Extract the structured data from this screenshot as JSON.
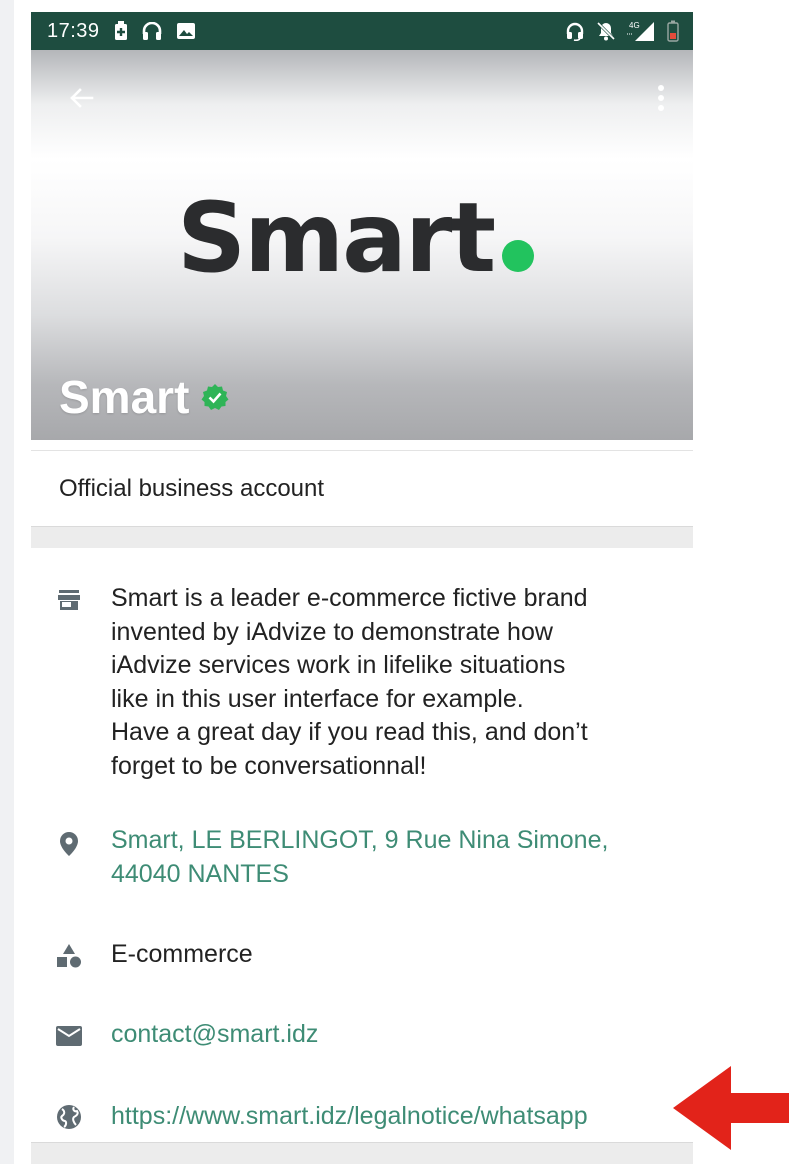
{
  "status_bar": {
    "time": "17:39",
    "left_icons": [
      "battery-saver-icon",
      "headphones-icon",
      "image-icon"
    ],
    "right_icons": [
      "headset-icon",
      "mute-notifications-icon",
      "4g-signal-icon",
      "battery-icon"
    ],
    "network": "4G"
  },
  "header": {
    "back_icon": "arrow-back-icon",
    "menu_icon": "more-vert-icon",
    "logo_text": "Smart",
    "business_name": "Smart",
    "verified_icon": "verified-badge-icon"
  },
  "official": {
    "label": "Official business account"
  },
  "info": {
    "description": "Smart is a leader e-commerce fictive brand\ninvented by iAdvize to demonstrate how\niAdvize services work in lifelike situations\nlike in this user interface for example.\nHave a great day if you read this, and don’t\nforget to be conversationnal!",
    "address": "Smart, LE BERLINGOT, 9 Rue Nina Simone,\n44040 NANTES",
    "category": "E-commerce",
    "email": "contact@smart.idz",
    "website": "https://www.smart.idz/legalnotice/whatsapp"
  },
  "annotation": {
    "icon": "red-arrow-icon",
    "color": "#e2231a"
  },
  "colors": {
    "status_bar": "#1e4d40",
    "link": "#3e8c75",
    "icon_gray": "#5f6b72",
    "verified": "#2fb457",
    "logo_dot": "#22c35e",
    "logo_text": "#2b2c2e"
  }
}
